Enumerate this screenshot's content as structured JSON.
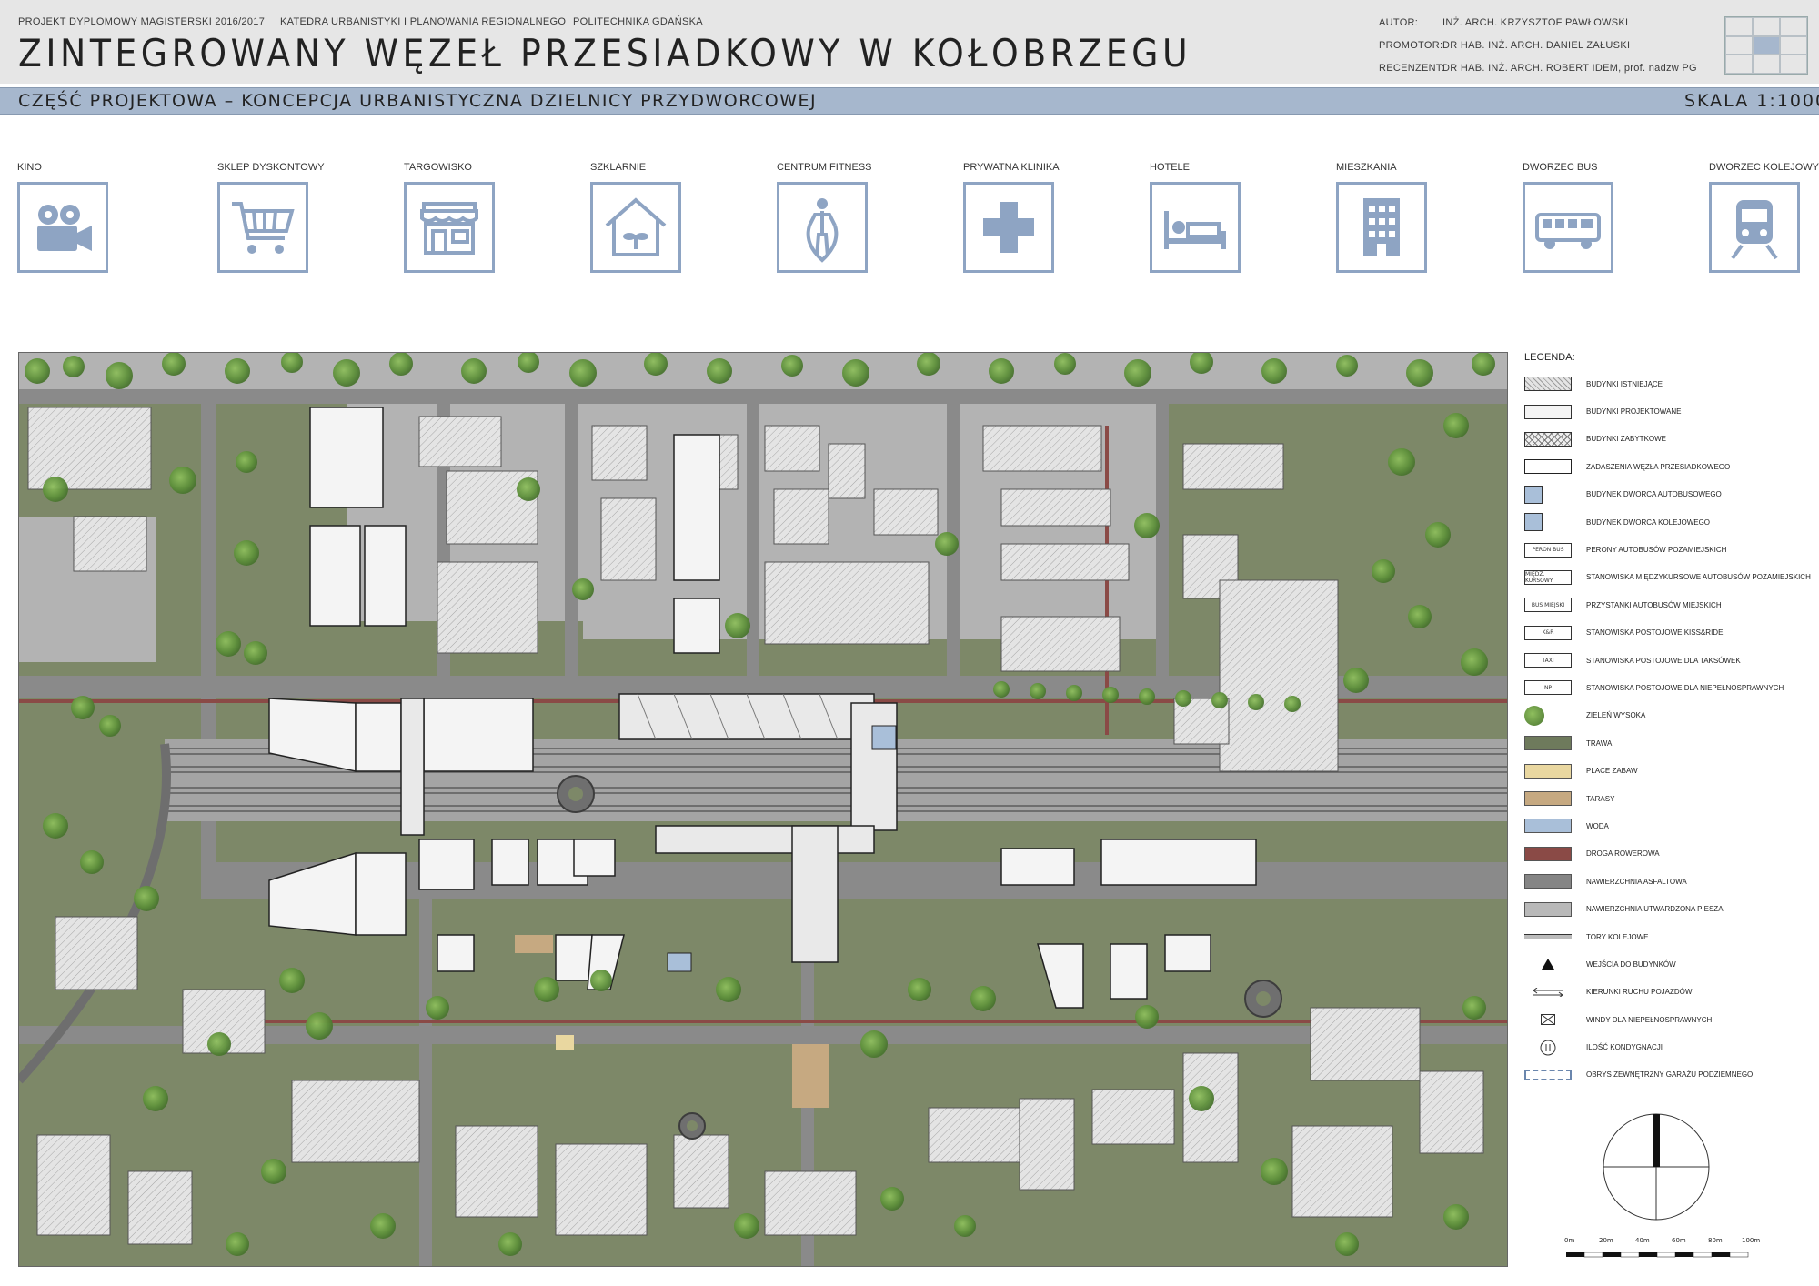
{
  "header": {
    "project": "PROJEKT DYPLOMOWY MAGISTERSKI 2016/2017",
    "department": "KATEDRA URBANISTYKI I PLANOWANIA REGIONALNEGO",
    "university": "POLITECHNIKA GDAŃSKA",
    "title": "ZINTEGROWANY WĘZEŁ PRZESIADKOWY W KOŁOBRZEGU",
    "credits": [
      {
        "role": "AUTOR:",
        "name": "INŻ. ARCH. KRZYSZTOF PAWŁOWSKI"
      },
      {
        "role": "PROMOTOR:",
        "name": "DR HAB. INŻ. ARCH. DANIEL ZAŁUSKI"
      },
      {
        "role": "RECENZENT:",
        "name": "DR HAB. INŻ. ARCH. ROBERT IDEM, prof. nadzw PG"
      }
    ]
  },
  "band": {
    "section": "CZĘŚĆ PROJEKTOWA – KONCEPCJA URBANISTYCZNA DZIELNICY PRZYDWORCOWEJ",
    "scale": "SKALA 1:1000"
  },
  "functions": [
    {
      "label": "KINO",
      "icon": "movie-camera-icon"
    },
    {
      "label": "SKLEP DYSKONTOWY",
      "icon": "shopping-cart-icon"
    },
    {
      "label": "TARGOWISKO",
      "icon": "market-stall-icon"
    },
    {
      "label": "SZKLARNIE",
      "icon": "greenhouse-icon"
    },
    {
      "label": "CENTRUM FITNESS",
      "icon": "jump-rope-icon"
    },
    {
      "label": "PRYWATNA KLINIKA",
      "icon": "medical-cross-icon"
    },
    {
      "label": "HOTELE",
      "icon": "bed-icon"
    },
    {
      "label": "MIESZKANIA",
      "icon": "apartment-building-icon"
    },
    {
      "label": "DWORZEC BUS",
      "icon": "bus-icon"
    },
    {
      "label": "DWORZEC KOLEJOWY",
      "icon": "train-icon"
    }
  ],
  "legend": {
    "title": "LEGENDA:",
    "items": [
      {
        "label": "BUDYNKI ISTNIEJĄCE",
        "symbol": "hatched"
      },
      {
        "label": "BUDYNKI PROJEKTOWANE",
        "symbol": "white"
      },
      {
        "label": "BUDYNKI ZABYTKOWE",
        "symbol": "cross-hatched"
      },
      {
        "label": "ZADASZENIA WĘZŁA PRZESIADKOWEGO",
        "symbol": "white-outline"
      },
      {
        "label": "BUDYNEK DWORCA AUTOBUSOWEGO",
        "symbol": "bus-station"
      },
      {
        "label": "BUDYNEK DWORCA KOLEJOWEGO",
        "symbol": "train-station"
      },
      {
        "label": "PERONY AUTOBUSÓW POZAMIEJSKICH",
        "symbol": "tag",
        "tag": "PERON BUS"
      },
      {
        "label": "STANOWISKA MIĘDZYKURSOWE AUTOBUSÓW POZAMIEJSKICH",
        "symbol": "tag",
        "tag": "MIĘDZ. KURSOWY"
      },
      {
        "label": "PRZYSTANKI AUTOBUSÓW MIEJSKICH",
        "symbol": "tag",
        "tag": "BUS MIEJSKI"
      },
      {
        "label": "STANOWISKA POSTOJOWE KISS&RIDE",
        "symbol": "tag",
        "tag": "K&R"
      },
      {
        "label": "STANOWISKA POSTOJOWE DLA TAKSÓWEK",
        "symbol": "tag",
        "tag": "TAXI"
      },
      {
        "label": "STANOWISKA POSTOJOWE DLA NIEPEŁNOSPRAWNYCH",
        "symbol": "tag",
        "tag": "NP"
      },
      {
        "label": "ZIELEŃ WYSOKA",
        "symbol": "tree"
      },
      {
        "label": "TRAWA",
        "symbol": "fill",
        "color": "#6e7a5c"
      },
      {
        "label": "PLACE ZABAW",
        "symbol": "fill",
        "color": "#e9d7a0"
      },
      {
        "label": "TARASY",
        "symbol": "fill",
        "color": "#c6a981"
      },
      {
        "label": "WODA",
        "symbol": "fill",
        "color": "#a9bfd9"
      },
      {
        "label": "DROGA ROWEROWA",
        "symbol": "fill",
        "color": "#8a4a46"
      },
      {
        "label": "NAWIERZCHNIA ASFALTOWA",
        "symbol": "fill",
        "color": "#858585"
      },
      {
        "label": "NAWIERZCHNIA UTWARDZONA PIESZA",
        "symbol": "fill",
        "color": "#b9b9b9"
      },
      {
        "label": "TORY KOLEJOWE",
        "symbol": "rail"
      },
      {
        "label": "WEJŚCIA DO BUDYNKÓW",
        "symbol": "triangle"
      },
      {
        "label": "KIERUNKI RUCHU POJAZDÓW",
        "symbol": "arrows"
      },
      {
        "label": "WINDY DLA NIEPEŁNOSPRAWNYCH",
        "symbol": "elevator"
      },
      {
        "label": "ILOŚĆ KONDYGNACJI",
        "symbol": "floors"
      },
      {
        "label": "OBRYS ZEWNĘTRZNY GARAŻU PODZIEMNEGO",
        "symbol": "dashed"
      }
    ]
  },
  "scale_bar": {
    "ticks": [
      "0m",
      "20m",
      "40m",
      "60m",
      "80m",
      "100m"
    ]
  }
}
